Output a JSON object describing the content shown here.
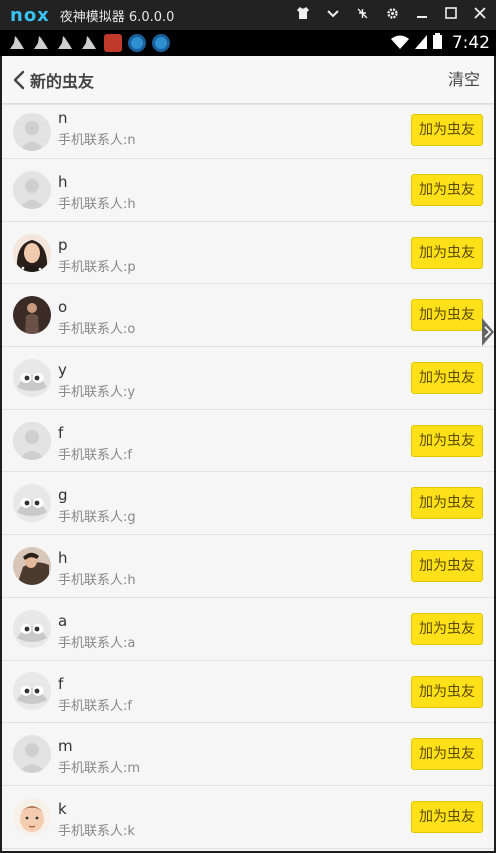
{
  "emulator": {
    "logo": "nox",
    "title": "夜神模拟器 6.0.0.0",
    "controls": [
      "shirt-icon",
      "chevron-down-icon",
      "pin-icon",
      "gear-icon",
      "minimize-icon",
      "maximize-icon",
      "close-icon"
    ]
  },
  "status_bar": {
    "time": "7:42",
    "notification_icons": [
      "ship-icon",
      "ship-icon",
      "ship-icon",
      "ship-icon",
      "app-icon-red",
      "app-icon-blue",
      "app-icon-blue"
    ]
  },
  "header": {
    "title": "新的虫友",
    "clear_label": "清空"
  },
  "contacts": [
    {
      "name": "n",
      "sub": "手机联系人:n",
      "avatar": "default",
      "button": "加为虫友"
    },
    {
      "name": "h",
      "sub": "手机联系人:h",
      "avatar": "default",
      "button": "加为虫友"
    },
    {
      "name": "p",
      "sub": "手机联系人:p",
      "avatar": "photo-woman",
      "button": "加为虫友"
    },
    {
      "name": "o",
      "sub": "手机联系人:o",
      "avatar": "photo-man",
      "button": "加为虫友"
    },
    {
      "name": "y",
      "sub": "手机联系人:y",
      "avatar": "bug-face",
      "button": "加为虫友"
    },
    {
      "name": "f",
      "sub": "手机联系人:f",
      "avatar": "default",
      "button": "加为虫友"
    },
    {
      "name": "g",
      "sub": "手机联系人:g",
      "avatar": "bug-face",
      "button": "加为虫友"
    },
    {
      "name": "h",
      "sub": "手机联系人:h",
      "avatar": "photo-man2",
      "button": "加为虫友"
    },
    {
      "name": "a",
      "sub": "手机联系人:a",
      "avatar": "bug-face",
      "button": "加为虫友"
    },
    {
      "name": "f",
      "sub": "手机联系人:f",
      "avatar": "bug-face",
      "button": "加为虫友"
    },
    {
      "name": "m",
      "sub": "手机联系人:m",
      "avatar": "default",
      "button": "加为虫友"
    },
    {
      "name": "k",
      "sub": "手机联系人:k",
      "avatar": "photo-baby",
      "button": "加为虫友"
    }
  ],
  "colors": {
    "accent_button": "#ffe11a",
    "header_bg": "#f7f7f7",
    "list_bg": "#f6f6f6"
  }
}
